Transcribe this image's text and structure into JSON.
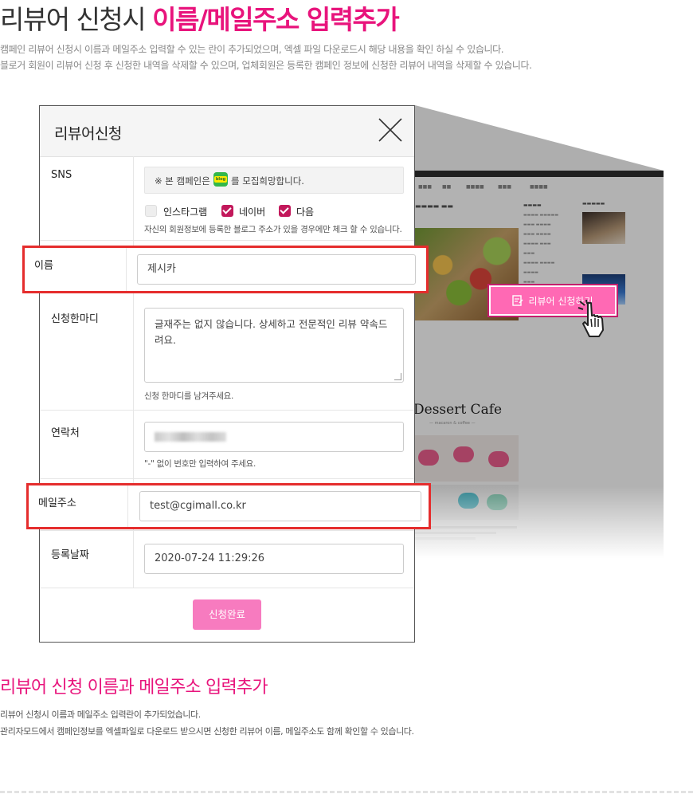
{
  "header": {
    "title_plain": "리뷰어 신청시 ",
    "title_highlight": "이름/메일주소 입력추가",
    "desc_lines": [
      "캠페인 리뷰어 신청시 이름과 메일주소 입력할 수 있는 란이 추가되었으며, 엑셀 파일 다운로드시 해당 내용을 확인 하실 수 있습니다.",
      "블로거 회원이 리뷰어 신청 후 신청한 내역을 삭제할 수 있으며, 업체회원은 등록한 캠페인 정보에 신청한 리뷰어 내역을 삭제할 수 있습니다."
    ]
  },
  "modal": {
    "title": "리뷰어신청",
    "sns": {
      "label": "SNS",
      "notice_prefix": "※ 본 캠페인은",
      "notice_suffix": "를 모집희망합니다.",
      "blog_icon_text": "blog",
      "options": [
        {
          "label": "인스타그램",
          "checked": false
        },
        {
          "label": "네이버",
          "checked": true
        },
        {
          "label": "다음",
          "checked": true
        }
      ],
      "hint": "자신의 회원정보에 등록한 블로그 주소가 있을 경우에만 체크 할 수 있습니다."
    },
    "name": {
      "label": "이름",
      "value": "제시카"
    },
    "comment": {
      "label": "신청한마디",
      "value": "글재주는 없지 않습니다. 상세하고 전문적인 리뷰 약속드려요.",
      "hint": "신청 한마디를 남겨주세요."
    },
    "contact": {
      "label": "연락처",
      "hint": "\"-\" 없이 번호만 입력하여 주세요."
    },
    "email": {
      "label": "메일주소",
      "value": "test@cgimall.co.kr"
    },
    "date": {
      "label": "등록날짜",
      "value": "2020-07-24 11:29:26"
    },
    "submit_label": "신청완료"
  },
  "preview": {
    "apply_button": "리뷰어 신청하기",
    "cafe_title": "Dessert Cafe",
    "cafe_sub": "— macaron & coffee —"
  },
  "section2": {
    "title": "리뷰어 신청 이름과 메일주소 입력추가",
    "desc_lines": [
      "리뷰어 신청시 이름과 메일주소 입력란이 추가되었습니다.",
      "관리자모드에서 캠페인정보를 엑셀파일로 다운로드 받으시면 신청한 리뷰어 이름, 메일주소도 함께 확인할 수 있습니다."
    ]
  },
  "colors": {
    "accent": "#e8147c",
    "highlight_border": "#e52d2d",
    "checkbox": "#c2185b",
    "button": "#f77bbf"
  }
}
